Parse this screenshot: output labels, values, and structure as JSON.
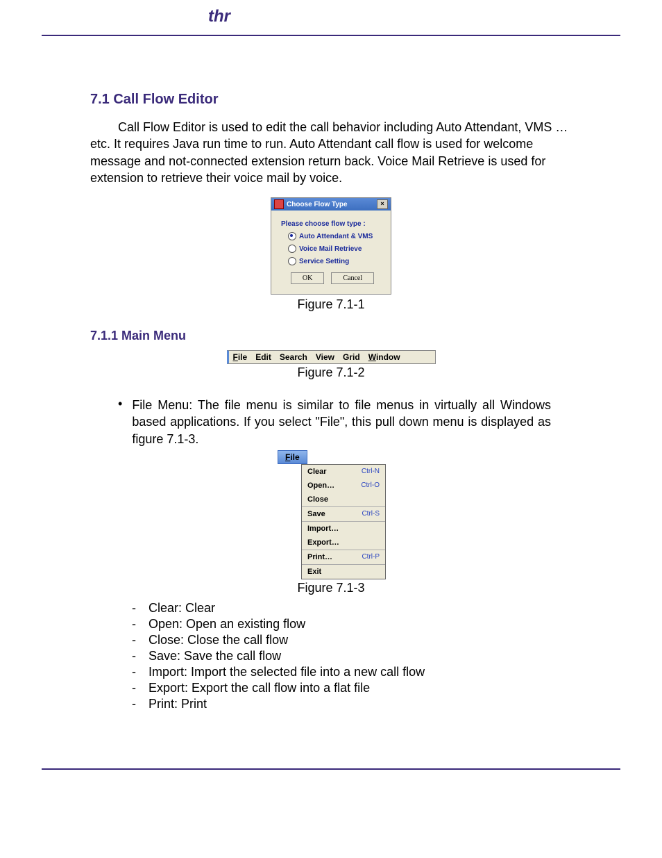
{
  "logo_text": "thr",
  "heading": "7.1 Call Flow Editor",
  "intro": "Call Flow Editor is used to edit the call behavior including Auto Attendant, VMS …etc. It requires Java run time to run. Auto Attendant call flow is used for welcome message and not-connected extension return back. Voice Mail Retrieve is used for extension to retrieve their voice mail by voice.",
  "dialog": {
    "title": "Choose Flow Type",
    "prompt": "Please choose flow type :",
    "options": [
      "Auto Attendant & VMS",
      "Voice Mail Retrieve",
      "Service Setting"
    ],
    "selected_index": 0,
    "ok": "OK",
    "cancel": "Cancel"
  },
  "fig1_caption": "Figure 7.1-1",
  "subheading": "7.1.1 Main Menu",
  "menubar": {
    "items": [
      {
        "pre": "",
        "u": "F",
        "post": "ile"
      },
      {
        "pre": "Edit",
        "u": "",
        "post": ""
      },
      {
        "pre": "Search",
        "u": "",
        "post": ""
      },
      {
        "pre": "View",
        "u": "",
        "post": ""
      },
      {
        "pre": "Grid",
        "u": "",
        "post": ""
      },
      {
        "pre": "",
        "u": "W",
        "post": "indow"
      }
    ]
  },
  "fig2_caption": "Figure 7.1-2",
  "bullet_text": "File Menu: The file menu is similar to file menus in virtually all Windows based applications. If you select \"File\", this pull down menu is displayed as figure 7.1-3.",
  "filemenu_tab": {
    "u": "F",
    "post": "ile"
  },
  "filemenu": [
    {
      "label": "Clear",
      "shortcut": "Ctrl-N"
    },
    {
      "label": "Open…",
      "shortcut": "Ctrl-O"
    },
    {
      "label": "Close",
      "shortcut": ""
    },
    {
      "sep": true
    },
    {
      "label": "Save",
      "shortcut": "Ctrl-S"
    },
    {
      "sep": true
    },
    {
      "label": "Import…",
      "shortcut": ""
    },
    {
      "label": "Export…",
      "shortcut": ""
    },
    {
      "sep": true
    },
    {
      "label": "Print…",
      "shortcut": "Ctrl-P"
    },
    {
      "sep": true
    },
    {
      "label": "Exit",
      "shortcut": ""
    }
  ],
  "fig3_caption": "Figure 7.1-3",
  "dashlist": [
    "Clear: Clear",
    "Open: Open an existing flow",
    "Close: Close the call flow",
    "Save: Save the call flow",
    "Import: Import the selected file into a new call flow",
    "Export: Export the call flow into a flat file",
    "Print: Print"
  ]
}
